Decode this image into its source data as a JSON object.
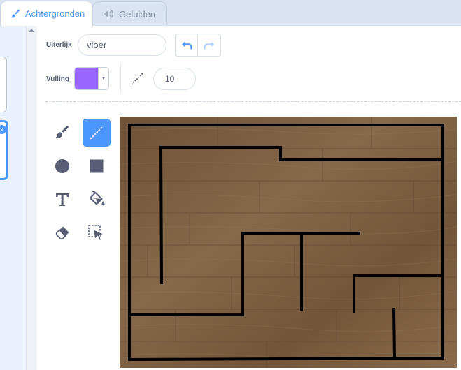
{
  "tabs": [
    {
      "label": "Achtergronden",
      "active": true,
      "icon": "paintbrush-icon"
    },
    {
      "label": "Geluiden",
      "active": false,
      "icon": "speaker-icon"
    }
  ],
  "costume": {
    "label": "Uiterlijk",
    "name": "vloer"
  },
  "fill": {
    "label": "Vulling",
    "color": "#9966ff"
  },
  "line_width": {
    "value": "10"
  },
  "colors": {
    "accent": "#4c97ff",
    "maze_wall": "#000000",
    "wood": "#7a5c3e"
  },
  "tools": [
    {
      "name": "brush-tool",
      "icon": "brush-icon",
      "selected": false
    },
    {
      "name": "line-tool",
      "icon": "line-icon",
      "selected": true
    },
    {
      "name": "circle-tool",
      "icon": "circle-icon",
      "selected": false
    },
    {
      "name": "rectangle-tool",
      "icon": "rectangle-icon",
      "selected": false
    },
    {
      "name": "text-tool",
      "icon": "text-icon",
      "selected": false
    },
    {
      "name": "fill-tool",
      "icon": "paint-bucket-icon",
      "selected": false
    },
    {
      "name": "eraser-tool",
      "icon": "eraser-icon",
      "selected": false
    },
    {
      "name": "select-tool",
      "icon": "select-icon",
      "selected": false
    }
  ]
}
